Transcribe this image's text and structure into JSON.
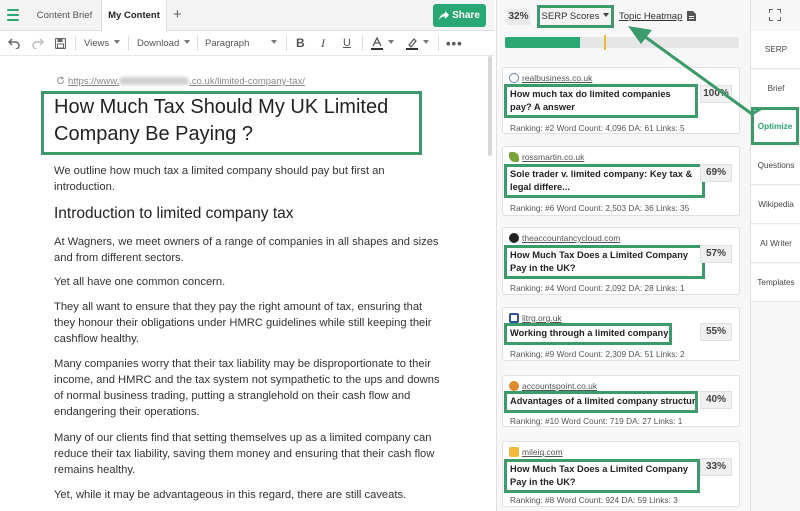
{
  "tabs": [
    {
      "label": "Content Brief"
    },
    {
      "label": "My Content"
    }
  ],
  "share_label": "Share",
  "toolbar": {
    "views": "Views",
    "download": "Download",
    "paragraph": "Paragraph"
  },
  "document": {
    "url_prefix": "https://www.",
    "url_suffix": ".co.uk/limited-company-tax/",
    "title": "How Much Tax Should My UK Limited Company Be Paying ?",
    "intro": "We outline how much tax a limited company should pay but first an introduction.",
    "heading": "Introduction to limited company tax",
    "paragraphs": [
      "At Wagners, we meet owners of a range of companies in all shapes and sizes and from different sectors.",
      "Yet all have one common concern.",
      "They all want to ensure that they pay the right amount of tax, ensuring that they honour their obligations under HMRC guidelines while still keeping their cashflow healthy.",
      "Many companies worry that their tax liability may be disproportionate to their income, and HMRC and the tax system not sympathetic to the ups and downs of normal business trading, putting a stranglehold on their cash flow and endangering their operations.",
      "Many of our clients find that setting themselves up as a limited company can reduce their tax liability, saving them money and ensuring that their cash flow remains healthy.",
      "Yet, while it may be advantageous in this regard, there are still caveats."
    ]
  },
  "serp": {
    "score": "32%",
    "dropdown_label": "SERP Scores",
    "heatmap_link": "Topic Heatmap",
    "progress_fraction": 0.32,
    "results": [
      {
        "site": "realbusiness.co.uk",
        "title": "How much tax do limited companies pay? A answer",
        "score": "100%",
        "meta": "Ranking: #2  Word Count: 4,096  DA: 61  Links: 5",
        "fav_color": "#6a7fb5"
      },
      {
        "site": "rossmartin.co.uk",
        "title": "Sole trader v. limited company: Key tax & legal differe...",
        "score": "69%",
        "meta": "Ranking: #6  Word Count: 2,503  DA: 36  Links: 35",
        "fav_color": "#7aa33a"
      },
      {
        "site": "theaccountancycloud.com",
        "title": "How Much Tax Does a Limited Company Pay in the UK?",
        "score": "57%",
        "meta": "Ranking: #4  Word Count: 2,092  DA: 28  Links: 1",
        "fav_color": "#222222"
      },
      {
        "site": "litrg.org.uk",
        "title": "Working through a limited company",
        "score": "55%",
        "meta": "Ranking: #9  Word Count: 2,309  DA: 51  Links: 2",
        "fav_color": "#2d4fa0"
      },
      {
        "site": "accountspoint.co.uk",
        "title": "Advantages of a limited company structure",
        "score": "40%",
        "meta": "Ranking: #10  Word Count: 719  DA: 27  Links: 1",
        "fav_color": "#e08a2a"
      },
      {
        "site": "mileiq.com",
        "title": "How Much Tax Does a Limited Company Pay in the UK?",
        "score": "33%",
        "meta": "Ranking: #8  Word Count: 924  DA: 59  Links: 3",
        "fav_color": "#f2b93b"
      }
    ]
  },
  "nav": [
    {
      "label": "SERP"
    },
    {
      "label": "Brief"
    },
    {
      "label": "Optimize"
    },
    {
      "label": "Questions"
    },
    {
      "label": "Wikipedia"
    },
    {
      "label": "AI Writer"
    },
    {
      "label": "Templates"
    }
  ],
  "colors": {
    "accent": "#2aa873",
    "highlight_border": "#3c9a6b",
    "marker": "#f2b93b"
  },
  "icons": [
    "menu-icon",
    "undo-icon",
    "redo-icon",
    "save-icon",
    "bold-icon",
    "italic-icon",
    "underline-icon",
    "text-color-icon",
    "highlight-icon",
    "more-icon",
    "share-icon",
    "document-icon",
    "expand-icon",
    "refresh-icon"
  ]
}
